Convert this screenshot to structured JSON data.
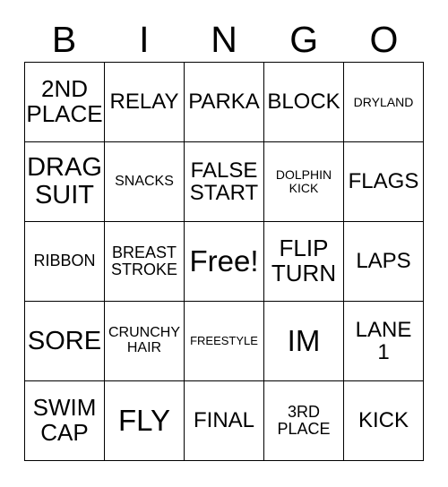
{
  "card": {
    "title_letters": [
      "B",
      "I",
      "N",
      "G",
      "O"
    ],
    "columns": [
      {
        "letter": "B",
        "cells": [
          {
            "text": "2ND\nPLACE",
            "size": "lg"
          },
          {
            "text": "DRAG\nSUIT",
            "size": "xl"
          },
          {
            "text": "RIBBON",
            "size": "sm"
          },
          {
            "text": "SORE",
            "size": "xl"
          },
          {
            "text": "SWIM\nCAP",
            "size": "lg"
          }
        ]
      },
      {
        "letter": "I",
        "cells": [
          {
            "text": "RELAY",
            "size": "md"
          },
          {
            "text": "SNACKS",
            "size": "xs"
          },
          {
            "text": "BREAST\nSTROKE",
            "size": "sm"
          },
          {
            "text": "CRUNCHY\nHAIR",
            "size": "xs"
          },
          {
            "text": "FLY",
            "size": "xxl"
          }
        ]
      },
      {
        "letter": "N",
        "cells": [
          {
            "text": "PARKA",
            "size": "md"
          },
          {
            "text": "FALSE\nSTART",
            "size": "md"
          },
          {
            "text": "Free!",
            "size": "xxl"
          },
          {
            "text": "FREESTYLE",
            "size": "tiny"
          },
          {
            "text": "FINAL",
            "size": "md"
          }
        ]
      },
      {
        "letter": "G",
        "cells": [
          {
            "text": "BLOCK",
            "size": "md"
          },
          {
            "text": "DOLPHIN\nKICK",
            "size": "xxs"
          },
          {
            "text": "FLIP\nTURN",
            "size": "lg"
          },
          {
            "text": "IM",
            "size": "xxl"
          },
          {
            "text": "3RD\nPLACE",
            "size": "sm"
          }
        ]
      },
      {
        "letter": "O",
        "cells": [
          {
            "text": "DRYLAND",
            "size": "xxs"
          },
          {
            "text": "FLAGS",
            "size": "md"
          },
          {
            "text": "LAPS",
            "size": "md"
          },
          {
            "text": "LANE\n1",
            "size": "md"
          },
          {
            "text": "KICK",
            "size": "md"
          }
        ]
      }
    ],
    "free_space": {
      "row": 2,
      "col": 2,
      "label": "Free!"
    },
    "colors": {
      "border": "#000000",
      "text": "#000000",
      "background": "#ffffff"
    }
  }
}
